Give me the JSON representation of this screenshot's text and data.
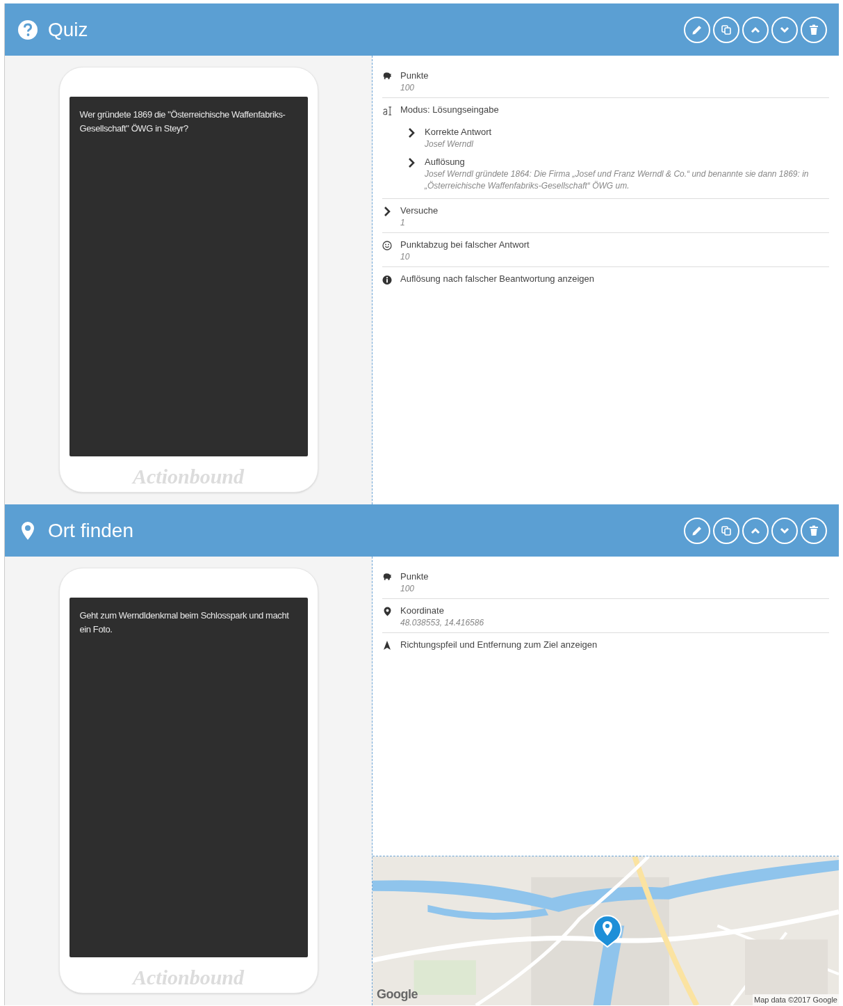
{
  "sections": [
    {
      "kind": "quiz",
      "title": "Quiz",
      "phone": {
        "question": "Wer gründete 1869 die \"Österreichische Waffenfabriks-Gesellschaft\" ÖWG in Steyr?",
        "brand": "Actionbound"
      },
      "properties": [
        {
          "kind": "points",
          "label": "Punkte",
          "value": "100"
        },
        {
          "kind": "mode",
          "label": "Modus: Lösungseingabe",
          "children": [
            {
              "label": "Korrekte Antwort",
              "value": "Josef Werndl"
            },
            {
              "label": "Auflösung",
              "value": "Josef Werndl gründete 1864: Die Firma „Josef und Franz Werndl & Co.“ und benannte sie dann 1869: in „Österreichische Waffenfabriks-Gesellschaft“ ÖWG um."
            }
          ]
        },
        {
          "kind": "chevron",
          "label": "Versuche",
          "value": "1"
        },
        {
          "kind": "smiley",
          "label": "Punktabzug bei falscher Antwort",
          "value": "10"
        },
        {
          "kind": "info",
          "label": "Auflösung nach falscher Beantwortung anzeigen"
        }
      ]
    },
    {
      "kind": "location",
      "title": "Ort finden",
      "phone": {
        "question": "Geht zum Werndldenkmal beim Schlosspark und macht ein Foto.",
        "brand": "Actionbound"
      },
      "properties": [
        {
          "kind": "points",
          "label": "Punkte",
          "value": "100"
        },
        {
          "kind": "pin",
          "label": "Koordinate",
          "value": "48.038553, 14.416586"
        },
        {
          "kind": "arrow",
          "label": "Richtungspfeil und Entfernung zum Ziel anzeigen"
        }
      ],
      "map": {
        "logo": "Google",
        "attribution": "Map data ©2017 Google"
      }
    }
  ]
}
